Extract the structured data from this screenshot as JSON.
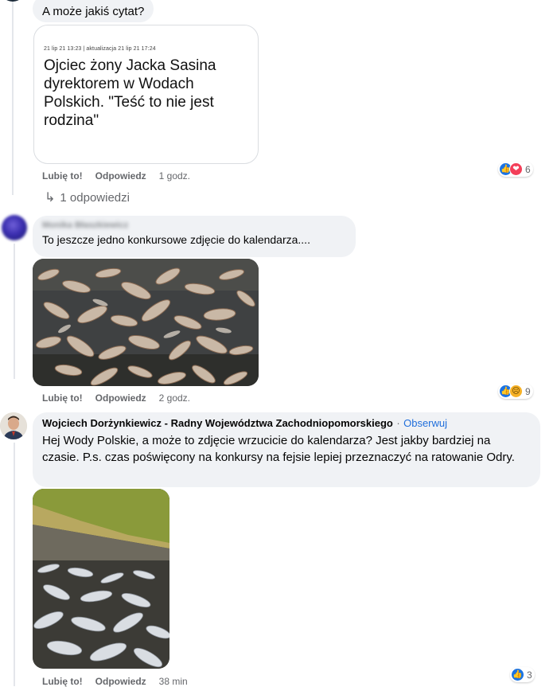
{
  "comment_top": {
    "text": "A może jakiś cytat?",
    "link_card": {
      "meta": "21 lip 21 13:23 | aktualizacja 21 lip 21 17:24",
      "title": "Ojciec żony Jacka Sasina dyrektorem w Wodach Polskich. \"Teść to nie jest rodzina\""
    },
    "actions": {
      "like": "Lubię to!",
      "reply": "Odpowiedz",
      "time": "1 godz."
    },
    "reactions": {
      "icons": [
        "like-icon",
        "love-icon"
      ],
      "count": "6"
    },
    "replies_link": "1 odpowiedzi"
  },
  "comment_second": {
    "author": "Monika Błaszkiewicz",
    "text": "To jeszcze jedno konkursowe zdjęcie do kalendarza....",
    "actions": {
      "like": "Lubię to!",
      "reply": "Odpowiedz",
      "time": "2 godz."
    },
    "reactions": {
      "icons": [
        "like-icon",
        "sad-icon"
      ],
      "count": "9"
    }
  },
  "comment_third": {
    "author": "Wojciech Dorżynkiewicz - Radny Województwa Zachodniopomorskiego",
    "separator": "·",
    "follow": "Obserwuj",
    "text": "Hej Wody Polskie, a może to zdjęcie wrzucicie do kalendarza? Jest jakby bardziej na czasie. P.s. czas poświęcony na konkursy na fejsie lepiej przeznaczyć na ratowanie Odry.",
    "actions": {
      "like": "Lubię to!",
      "reply": "Odpowiedz",
      "time": "38 min"
    },
    "reactions": {
      "icons": [
        "like-icon"
      ],
      "count": "3"
    }
  },
  "colors": {
    "bubble_bg": "#f0f2f5",
    "link_blue": "#216fdb",
    "meta_gray": "#65676b",
    "like_blue": "#1b74e4",
    "love_red": "#f33e58",
    "sad_yellow": "#f7b125"
  }
}
